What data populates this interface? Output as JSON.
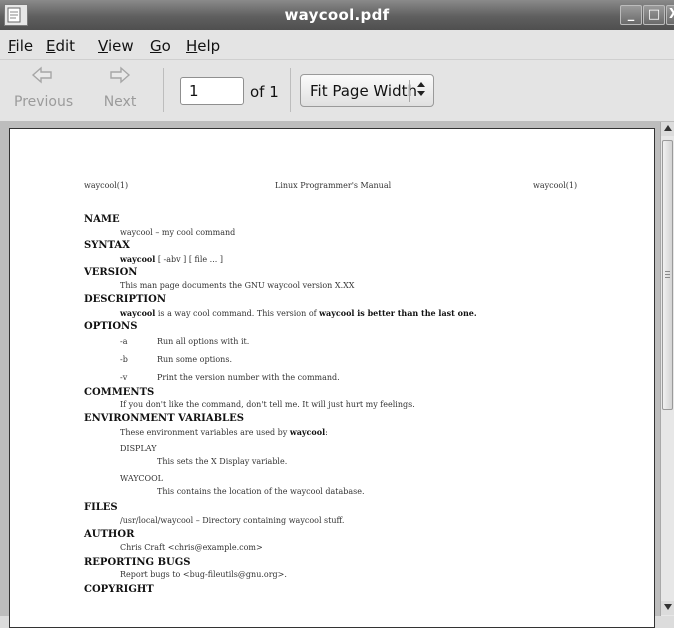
{
  "window": {
    "title": "waycool.pdf",
    "controls": {
      "minimize": "_",
      "maximize": "□",
      "close": "X"
    }
  },
  "menubar": [
    {
      "label": "File",
      "mnemonic": "F",
      "rest": "ile"
    },
    {
      "label": "Edit",
      "mnemonic": "E",
      "rest": "dit"
    },
    {
      "label": "View",
      "mnemonic": "V",
      "rest": "iew"
    },
    {
      "label": "Go",
      "mnemonic": "G",
      "rest": "o"
    },
    {
      "label": "Help",
      "mnemonic": "H",
      "rest": "elp"
    }
  ],
  "toolbar": {
    "previous_label": "Previous",
    "next_label": "Next",
    "page_value": "1",
    "of_pages": "of 1",
    "zoom_value": "Fit Page Width",
    "zoom_spin": "▲\n▼"
  },
  "document": {
    "header_left": "waycool(1)",
    "header_center": "Linux Programmer's Manual",
    "header_right": "waycool(1)",
    "sections": {
      "name": {
        "heading": "NAME",
        "text": "waycool – my cool command"
      },
      "syntax": {
        "heading": "SYNTAX",
        "cmd": "waycool",
        "args": "[ -abv ] [ file ... ]"
      },
      "version": {
        "heading": "VERSION",
        "text": "This man page documents the GNU waycool version X.XX"
      },
      "description": {
        "heading": "DESCRIPTION",
        "cmd": "waycool",
        "text1": "is a way cool command.  This version of",
        "bold": "waycool is better than the last one."
      },
      "options": {
        "heading": "OPTIONS",
        "items": [
          {
            "flag": "-a",
            "desc": "Run all options with it."
          },
          {
            "flag": "-b",
            "desc": "Run some options."
          },
          {
            "flag": "-v",
            "desc": "Print the version number with the command."
          }
        ]
      },
      "comments": {
        "heading": "COMMENTS",
        "text": "If you don't like the command, don't tell me. It will just hurt my feelings."
      },
      "environment": {
        "heading": "ENVIRONMENT VARIABLES",
        "intro": "These environment variables are used by",
        "intro_bold": "waycool",
        "intro_end": ":",
        "vars": [
          {
            "name": "DISPLAY",
            "desc": "This sets the X Display variable."
          },
          {
            "name": "WAYCOOL",
            "desc": "This contains the location of the waycool database."
          }
        ]
      },
      "files": {
        "heading": "FILES",
        "text": "/usr/local/waycool – Directory containing waycool stuff."
      },
      "author": {
        "heading": "AUTHOR",
        "text": "Chris Craft <chris@example.com>"
      },
      "bugs": {
        "heading": "REPORTING BUGS",
        "text": "Report bugs to <bug-fileutils@gnu.org>."
      },
      "copyright": {
        "heading": "COPYRIGHT"
      }
    }
  },
  "colors": {
    "titlebar": "#5f5f5f",
    "chrome": "#e4e4e4",
    "doc_background": "#bdbdbd",
    "page": "#ffffff"
  }
}
